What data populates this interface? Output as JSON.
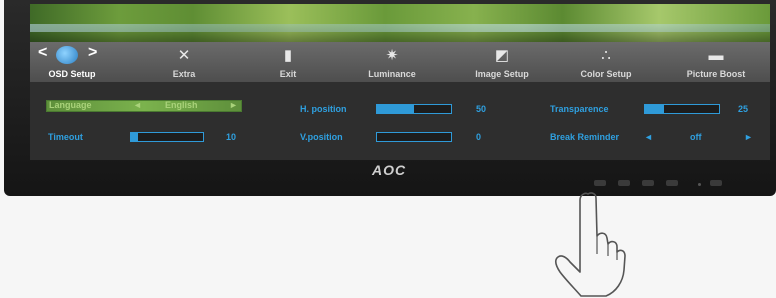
{
  "brand": {
    "logo": "AOC"
  },
  "tabs": [
    {
      "label": "OSD Setup",
      "icon": "globe-icon",
      "active": true
    },
    {
      "label": "Extra",
      "icon": "tools-icon"
    },
    {
      "label": "Exit",
      "icon": "exit-door-icon"
    },
    {
      "label": "Luminance",
      "icon": "sun-icon"
    },
    {
      "label": "Image Setup",
      "icon": "image-setup-icon"
    },
    {
      "label": "Color Setup",
      "icon": "color-dots-icon"
    },
    {
      "label": "Picture Boost",
      "icon": "picture-boost-icon"
    }
  ],
  "nav": {
    "prev": "<",
    "next": ">"
  },
  "settings": {
    "language": {
      "label": "Language",
      "value": "English",
      "left": "◄",
      "right": "►"
    },
    "timeout": {
      "label": "Timeout",
      "value": "10",
      "level": 0.1
    },
    "h_position": {
      "label": "H. position",
      "value": "50",
      "level": 0.5
    },
    "v_position": {
      "label": "V.position",
      "value": "0",
      "level": 0.0
    },
    "transparence": {
      "label": "Transparence",
      "value": "25",
      "level": 0.25
    },
    "break_reminder": {
      "label": "Break Reminder",
      "value": "off",
      "left": "◄",
      "right": "►"
    }
  },
  "colors": {
    "accent": "#2f9ad8",
    "menu_bg": "#5a5a5a",
    "content_bg": "#2e2e2e"
  }
}
